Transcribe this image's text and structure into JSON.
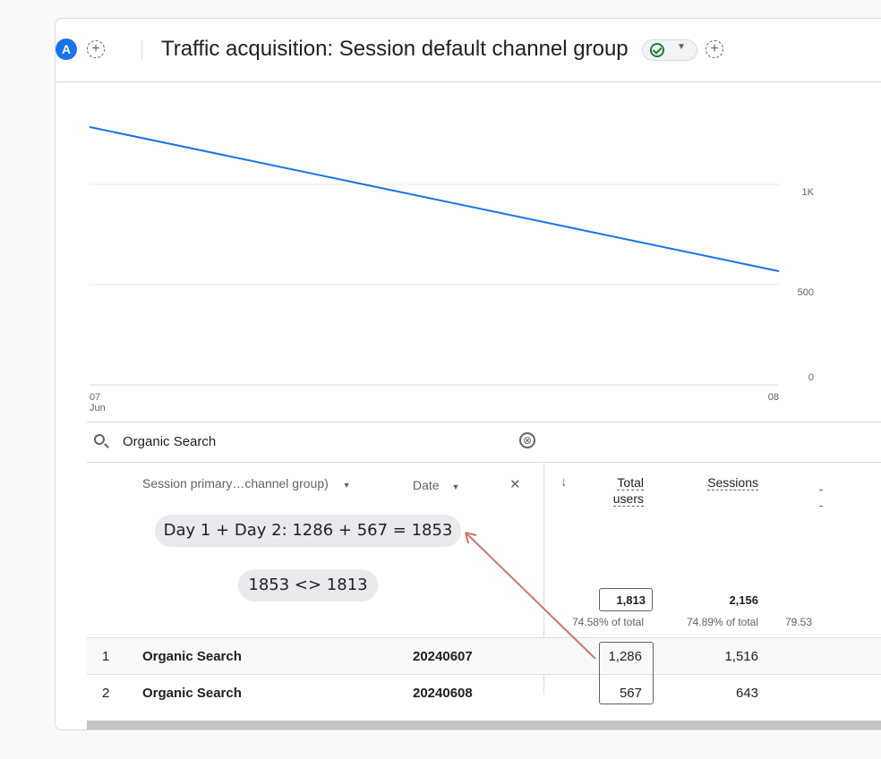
{
  "header": {
    "avatar_letter": "A",
    "add_comparison": "+",
    "title": "Traffic acquisition: Session default channel group",
    "add_report": "+"
  },
  "chart_data": {
    "type": "line",
    "x": [
      "07\nJun",
      "08"
    ],
    "x_tick_labels": [
      "07",
      "Jun",
      "08"
    ],
    "series": [
      {
        "values": [
          1286,
          567
        ],
        "color": "#1a73e8"
      }
    ],
    "y_ticks": [
      "1K",
      "500",
      "0"
    ],
    "ylim": [
      0,
      1500
    ],
    "grid": true
  },
  "search": {
    "value": "Organic Search",
    "clear": "⊗"
  },
  "table": {
    "dim1_header": "Session primary…channel group)",
    "dim2_header": "Date",
    "remove": "✕",
    "sort_arrow": "↓",
    "metric1_header_line1": "Total",
    "metric1_header_line2": "users",
    "metric2_header": "Sessions",
    "totals": {
      "users": "1,813",
      "users_pct": "74.58% of total",
      "sessions": "2,156",
      "sessions_pct": "74.89% of total",
      "third_pct": "79.53"
    },
    "rows": [
      {
        "index": "1",
        "channel": "Organic Search",
        "date": "20240607",
        "users": "1,286",
        "sessions": "1,516"
      },
      {
        "index": "2",
        "channel": "Organic Search",
        "date": "20240608",
        "users": "567",
        "sessions": "643"
      }
    ]
  },
  "annotations": {
    "sum_note": "Day 1 + Day 2: 1286 + 567 = 1853",
    "compare_note": "1853 <> 1813"
  }
}
